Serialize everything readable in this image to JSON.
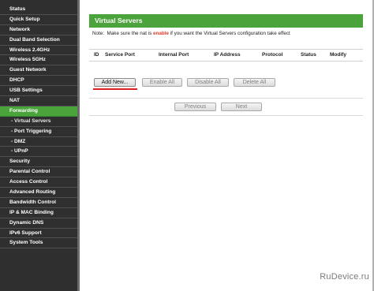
{
  "sidebar": {
    "items": [
      {
        "label": "Status"
      },
      {
        "label": "Quick Setup"
      },
      {
        "label": "Network"
      },
      {
        "label": "Dual Band Selection"
      },
      {
        "label": "Wireless 2.4GHz"
      },
      {
        "label": "Wireless 5GHz"
      },
      {
        "label": "Guest Network"
      },
      {
        "label": "DHCP"
      },
      {
        "label": "USB Settings"
      },
      {
        "label": "NAT"
      },
      {
        "label": "Forwarding"
      },
      {
        "label": "- Virtual Servers"
      },
      {
        "label": "- Port Triggering"
      },
      {
        "label": "- DMZ"
      },
      {
        "label": "- UPnP"
      },
      {
        "label": "Security"
      },
      {
        "label": "Parental Control"
      },
      {
        "label": "Access Control"
      },
      {
        "label": "Advanced Routing"
      },
      {
        "label": "Bandwidth Control"
      },
      {
        "label": "IP & MAC Binding"
      },
      {
        "label": "Dynamic DNS"
      },
      {
        "label": "IPv6 Support"
      },
      {
        "label": "System Tools"
      }
    ]
  },
  "main": {
    "title": "Virtual Servers",
    "note": {
      "prefix": "Note:",
      "before": "  Make sure the nat is ",
      "highlight": "enable",
      "after": " if you want the Virtual Servers configuration take effect"
    },
    "columns": [
      "ID",
      "Service Port",
      "Internal Port",
      "IP Address",
      "Protocol",
      "Status",
      "Modify"
    ],
    "buttons": {
      "add_new": "Add New...",
      "enable_all": "Enable All",
      "disable_all": "Disable All",
      "delete_all": "Delete All",
      "previous": "Previous",
      "next": "Next"
    }
  },
  "watermark": "RuDevice.ru"
}
